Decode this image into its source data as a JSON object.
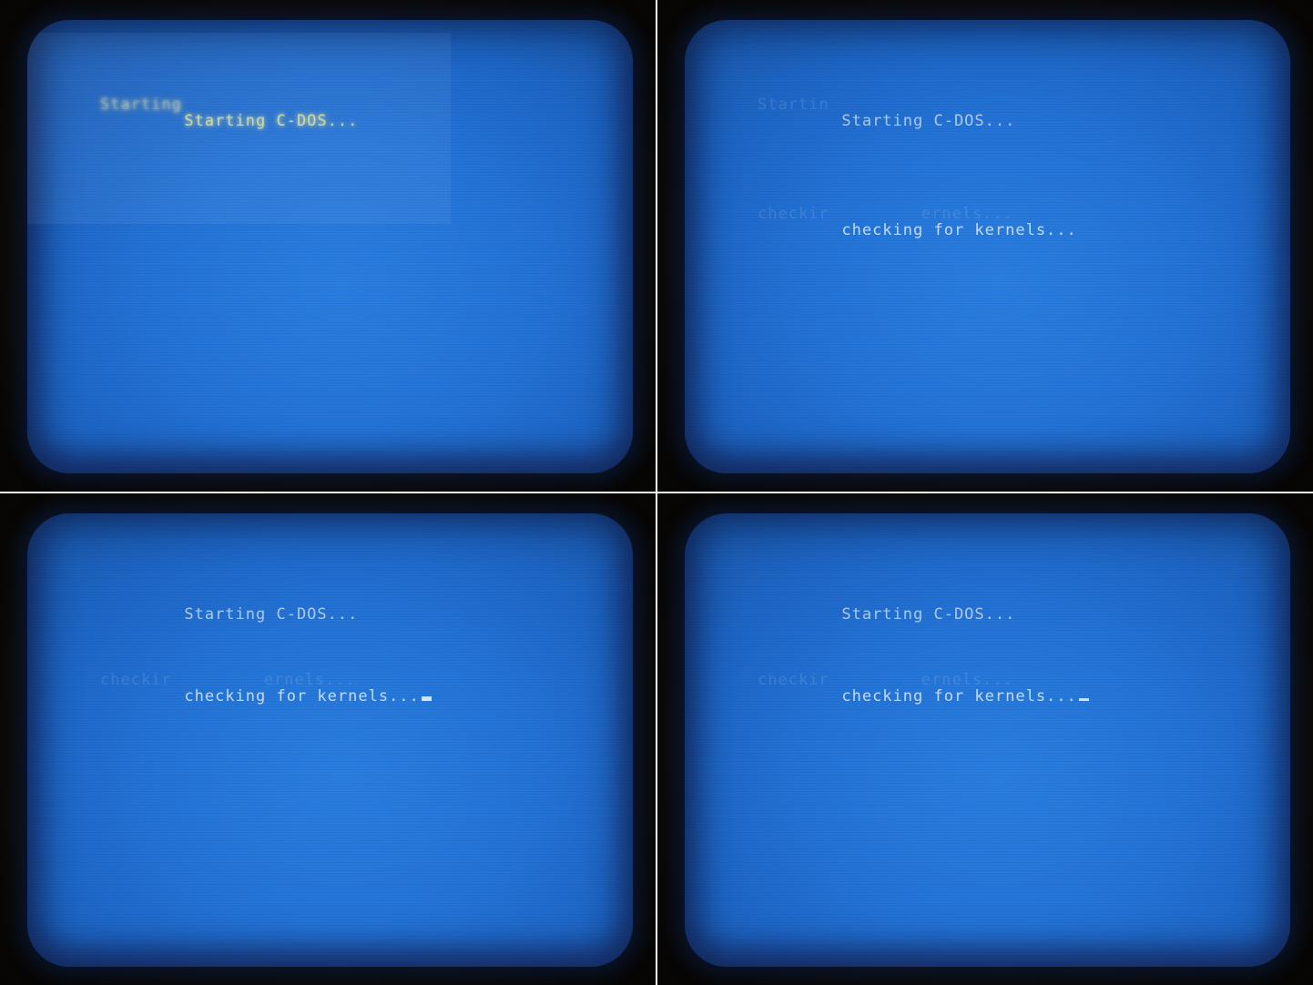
{
  "frames": [
    {
      "lines": [
        "Starting C-DOS..."
      ],
      "ghosts": [
        "Starting"
      ],
      "cursor": false
    },
    {
      "lines": [
        "Starting C-DOS...",
        "checking for kernels..."
      ],
      "ghosts": [
        "Startin",
        "checkir         ernels..."
      ],
      "cursor": false
    },
    {
      "lines": [
        "Starting C-DOS...",
        "checking for kernels..."
      ],
      "ghosts": [
        "",
        "checkir         ernels..."
      ],
      "cursor": true
    },
    {
      "lines": [
        "Starting C-DOS...",
        "checking for kernels..."
      ],
      "ghosts": [
        "",
        "checkir         ernels..."
      ],
      "cursor": true
    }
  ],
  "colors": {
    "screen_blue": "#2474d8",
    "text": "#d2e1f0",
    "bezel": "#0c0a08"
  }
}
